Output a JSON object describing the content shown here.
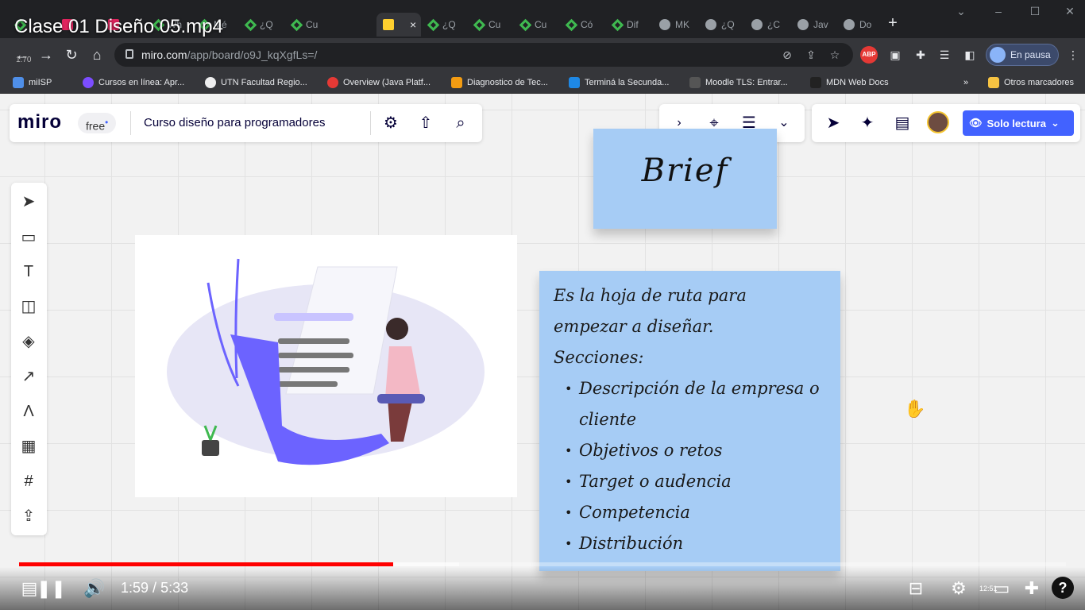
{
  "video": {
    "title": "Clase 01 Diseño 05.mp4",
    "time_current": "1:59",
    "time_total": "5:33",
    "time_separator": " / ",
    "progress_fraction": 0.357,
    "buffer_fraction": 0.42,
    "clock": "12:51"
  },
  "browser": {
    "tabs": [
      {
        "label": "",
        "icon": "tab-icon"
      },
      {
        "label": "",
        "icon": "youtube-icon"
      },
      {
        "label": "",
        "icon": "youtube-icon"
      },
      {
        "label": "Wh",
        "icon": "tab-icon"
      },
      {
        "label": "Mé",
        "icon": "tab-icon"
      },
      {
        "label": "¿Q",
        "icon": "tab-icon"
      },
      {
        "label": "Cu",
        "icon": "tab-icon"
      },
      {
        "label": "",
        "icon": "miro-icon",
        "active": true
      },
      {
        "label": "¿Q",
        "icon": "tab-icon"
      },
      {
        "label": "Cu",
        "icon": "tab-icon"
      },
      {
        "label": "Cu",
        "icon": "tab-icon"
      },
      {
        "label": "Có",
        "icon": "tab-icon"
      },
      {
        "label": "Dif",
        "icon": "tab-icon"
      },
      {
        "label": "MK",
        "icon": "globe-icon"
      },
      {
        "label": "¿Q",
        "icon": "globe-icon"
      },
      {
        "label": "¿C",
        "icon": "globe-icon"
      },
      {
        "label": "Jav",
        "icon": "globe-icon"
      },
      {
        "label": "Do",
        "icon": "globe-icon"
      }
    ],
    "zoom_label": "1.70",
    "url_host": "miro.com",
    "url_path": "/app/board/o9J_kqXgfLs=/",
    "profile_status": "En pausa",
    "bookmarks": [
      "miISP",
      "Cursos en línea: Apr...",
      "UTN Facultad Regio...",
      "Overview (Java Platf...",
      "Diagnostico de Tec...",
      "Terminá la Secunda...",
      "Moodle TLS: Entrar...",
      "MDN Web Docs"
    ],
    "bookmarks_overflow": "»",
    "other_bookmarks": "Otros marcadores"
  },
  "miro": {
    "logo": "miro",
    "plan_badge": "free",
    "board_name": "Curso diseño para programadores",
    "view_mode": "Solo lectura",
    "brief_sticky": "Brief",
    "content_sticky": {
      "intro_line1": "Es la hoja de ruta para",
      "intro_line2": "empezar a diseñar.",
      "sections_heading": "Secciones:",
      "sections": [
        "Descripción de la empresa o cliente",
        "Objetivos o retos",
        "Target o audencia",
        "Competencia",
        "Distribución"
      ]
    }
  },
  "colors": {
    "sticky_blue": "#a6ccf5",
    "miro_accent": "#4262ff",
    "progress_red": "#ff0000",
    "illustration_purple": "#6c63ff"
  }
}
